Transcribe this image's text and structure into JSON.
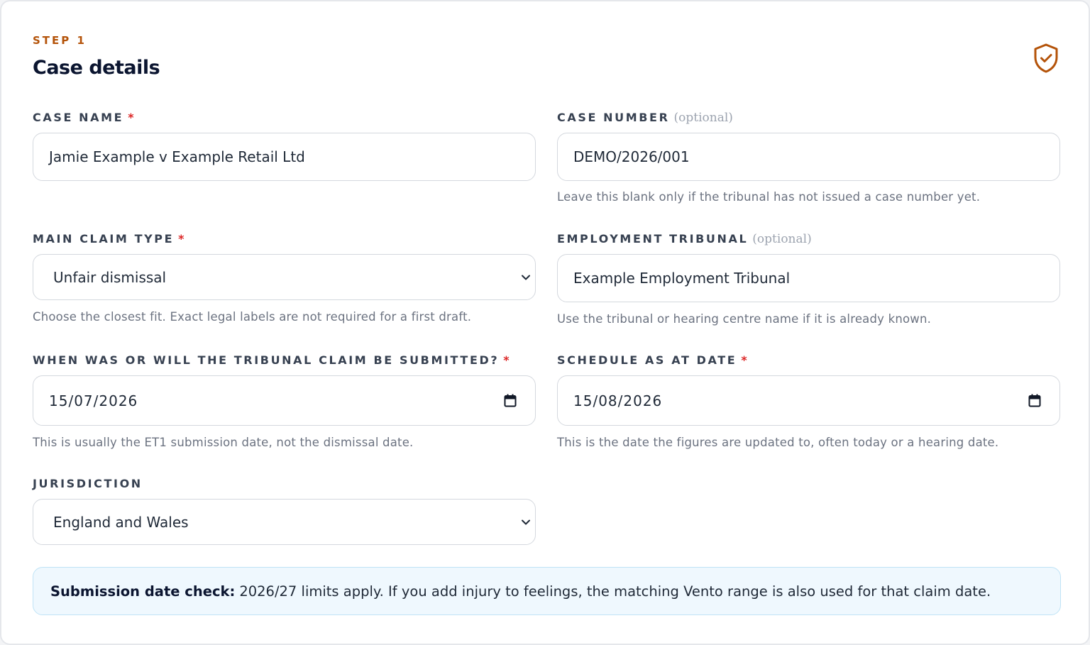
{
  "header": {
    "step": "STEP 1",
    "title": "Case details",
    "badge_icon": "shield-check-icon",
    "accent_color": "#b45309"
  },
  "fields": {
    "case_name": {
      "label": "CASE NAME",
      "required_marker": "*",
      "value": "Jamie Example v Example Retail Ltd"
    },
    "case_number": {
      "label": "CASE NUMBER",
      "optional_text": "(optional)",
      "value": "DEMO/2026/001",
      "hint": "Leave this blank only if the tribunal has not issued a case number yet."
    },
    "main_claim_type": {
      "label": "MAIN CLAIM TYPE",
      "required_marker": "*",
      "value": "Unfair dismissal",
      "hint": "Choose the closest fit. Exact legal labels are not required for a first draft."
    },
    "employment_tribunal": {
      "label": "EMPLOYMENT TRIBUNAL",
      "optional_text": "(optional)",
      "value": "Example Employment Tribunal",
      "hint": "Use the tribunal or hearing centre name if it is already known."
    },
    "submission_date": {
      "label": "WHEN WAS OR WILL THE TRIBUNAL CLAIM BE SUBMITTED?",
      "required_marker": "*",
      "value": "15/07/2026",
      "hint": "This is usually the ET1 submission date, not the dismissal date."
    },
    "schedule_date": {
      "label": "SCHEDULE AS AT DATE",
      "required_marker": "*",
      "value": "15/08/2026",
      "hint": "This is the date the figures are updated to, often today or a hearing date."
    },
    "jurisdiction": {
      "label": "JURISDICTION",
      "value": "England and Wales"
    }
  },
  "notice": {
    "title": "Submission date check:",
    "body": "2026/27 limits apply. If you add injury to feelings, the matching Vento range is also used for that claim date."
  }
}
